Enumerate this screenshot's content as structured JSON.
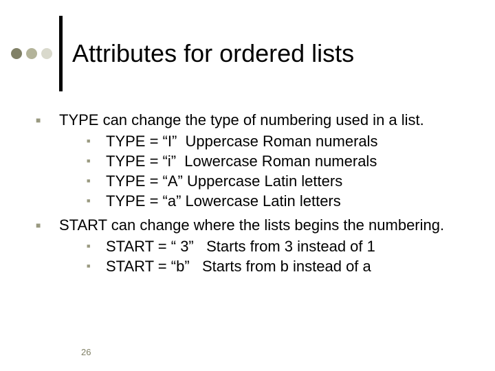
{
  "title": "Attributes for ordered lists",
  "bullets": [
    {
      "text": "TYPE can change the type of numbering used in a list.",
      "sub": [
        "TYPE = “I”  Uppercase Roman numerals",
        "TYPE = “i”  Lowercase Roman numerals",
        "TYPE = “A” Uppercase Latin letters",
        "TYPE = “a” Lowercase Latin letters"
      ]
    },
    {
      "text": "START can change where the lists begins the numbering.",
      "sub": [
        "START = “ 3”   Starts from 3 instead of 1",
        "START = “b”   Starts from b instead of a"
      ]
    }
  ],
  "page_number": "26"
}
